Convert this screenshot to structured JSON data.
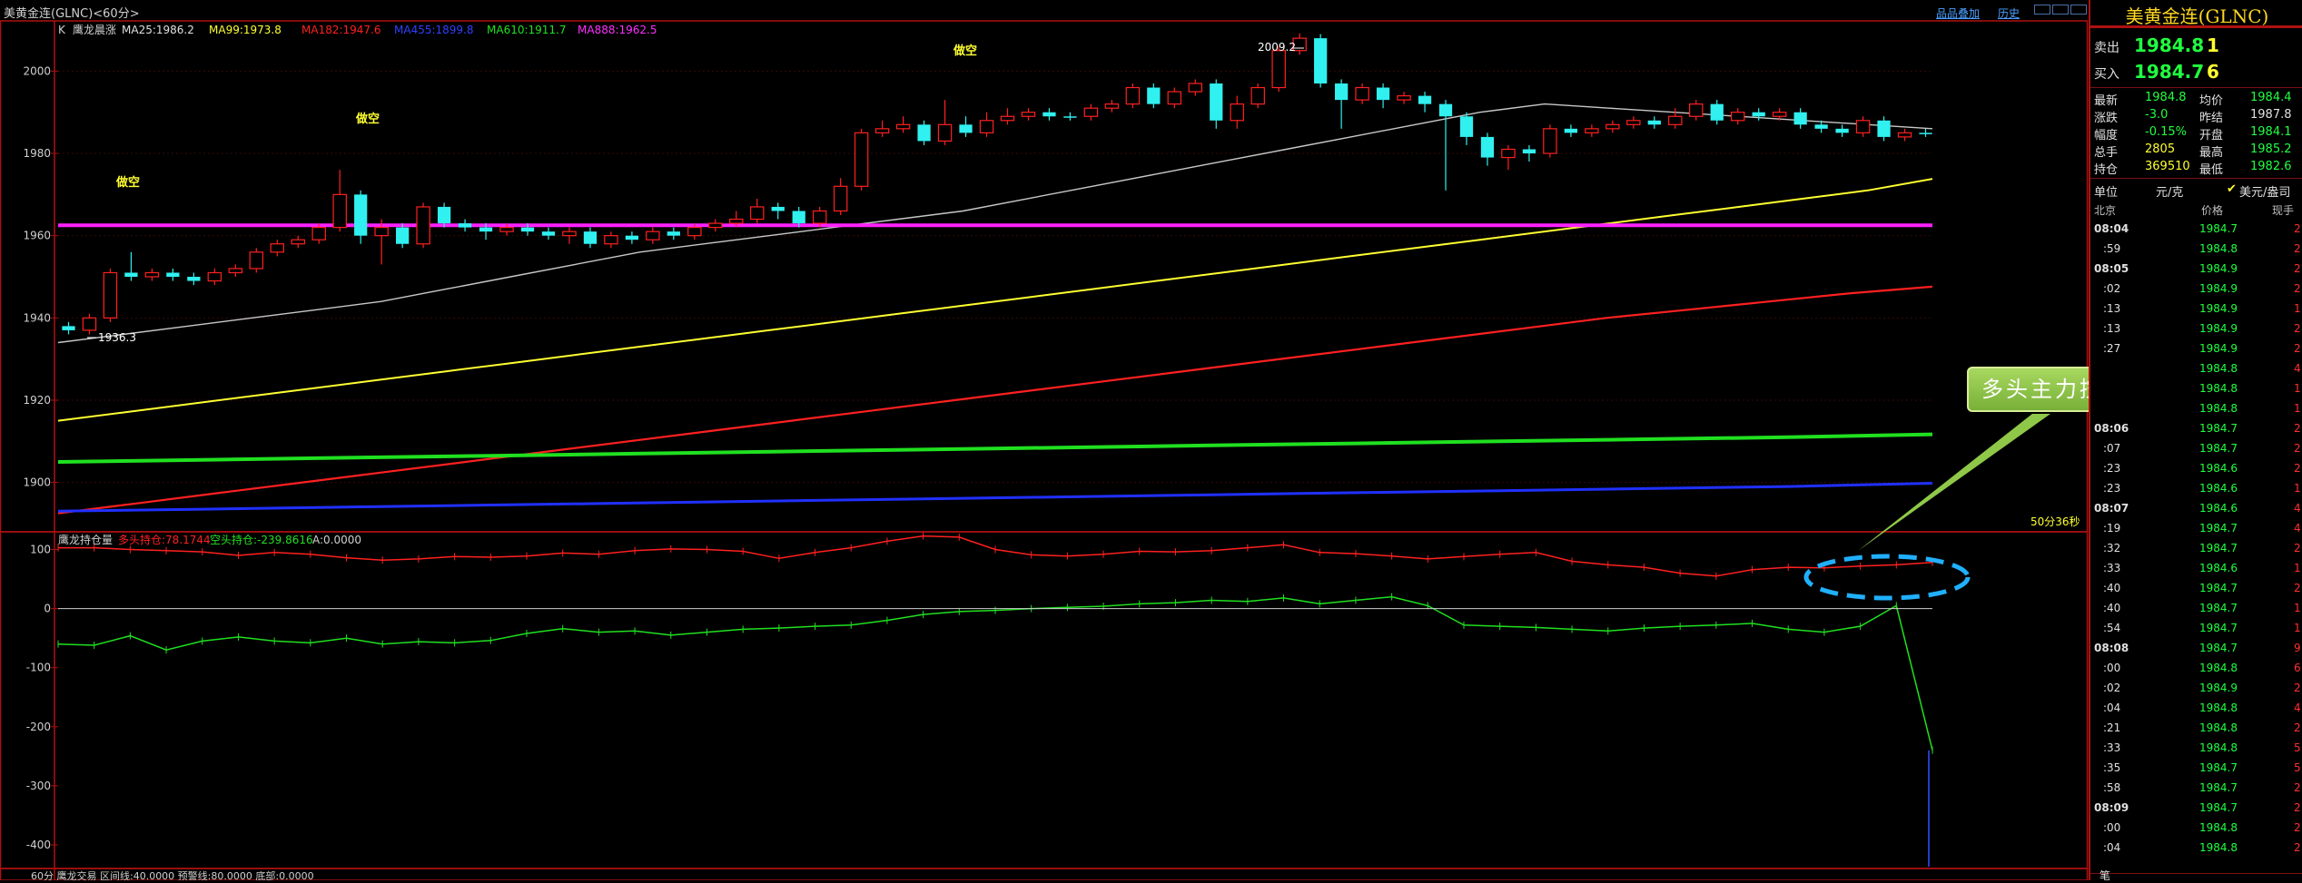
{
  "window": {
    "title": "美黄金连(GLNC)<60分>"
  },
  "toolbar": {
    "add_product": "品品叠加",
    "history": "历史",
    "colors": {
      "link": "#4aa0ff"
    }
  },
  "main_panel": {
    "indicator_header": {
      "prefix": "K",
      "name": "鹰龙晨涨",
      "ma25": "MA25:1986.2",
      "ma99": "MA99:1973.8",
      "ma182": "MA182:1947.6",
      "ma455": "MA455:1899.8",
      "ma610": "MA610:1911.7",
      "ma888": "MA888:1962.5"
    },
    "price_labels": {
      "high": "2009.2",
      "low": "1936.3"
    },
    "annotations": [
      "做空",
      "做空",
      "做空"
    ],
    "timer": "50分36秒"
  },
  "sub_panel": {
    "header": {
      "name": "鹰龙持仓量",
      "long": "多头持仓:78.1744",
      "short": "空头持仓:-239.8616",
      "a": "A:0.0000"
    }
  },
  "bottom_panel": {
    "header": "60分  鹰龙交易  区间线:40.0000  预警线:80.0000  底部:0.0000"
  },
  "callout": {
    "text": "多头主力控盘并且增仓"
  },
  "chart_data": [
    {
      "type": "candlestick",
      "title": "",
      "ylim": [
        1888,
        2012
      ],
      "yticks": [
        1900,
        1920,
        1940,
        1960,
        1980,
        2000
      ],
      "grid": false,
      "series": [
        {
          "name": "MA25",
          "color": "#c8c8c8",
          "values": [
            1934,
            1936,
            1938,
            1940,
            1942,
            1944,
            1947,
            1950,
            1953,
            1956,
            1958,
            1960,
            1962,
            1964,
            1966,
            1969,
            1972,
            1975,
            1978,
            1981,
            1984,
            1987,
            1990,
            1992,
            1991,
            1990,
            1989,
            1988,
            1987,
            1986
          ]
        },
        {
          "name": "MA99",
          "color": "#ffff30",
          "values": [
            1915,
            1917,
            1919,
            1921,
            1923,
            1925,
            1927,
            1929,
            1931,
            1933,
            1935,
            1937,
            1939,
            1941,
            1943,
            1945,
            1947,
            1949,
            1951,
            1953,
            1955,
            1957,
            1959,
            1961,
            1963,
            1965,
            1967,
            1969,
            1971,
            1973.8
          ]
        },
        {
          "name": "MA182",
          "color": "#ff2020",
          "values": [
            1892.5,
            1895,
            1897.5,
            1900,
            1902.5,
            1905,
            1907.5,
            1910,
            1912.5,
            1915,
            1917.5,
            1920,
            1922.5,
            1925,
            1927.5,
            1930,
            1932.5,
            1935,
            1937.5,
            1940,
            1942,
            1944,
            1946,
            1947.6
          ]
        },
        {
          "name": "MA455",
          "color": "#2030ff",
          "values": [
            1893,
            1893.5,
            1894,
            1894.5,
            1895,
            1895.5,
            1896,
            1896.5,
            1897,
            1897.5,
            1898,
            1898.5,
            1899,
            1899.8
          ]
        },
        {
          "name": "MA610",
          "color": "#20e020",
          "values": [
            1905,
            1905.5,
            1906,
            1906.5,
            1907,
            1907.5,
            1908,
            1908.5,
            1909,
            1909.5,
            1910,
            1910.5,
            1911,
            1911.7
          ]
        },
        {
          "name": "MA888",
          "color": "#ff20ff",
          "values": [
            1962.5,
            1962.5
          ]
        }
      ],
      "candles": [
        [
          1937,
          1938,
          1936,
          1939,
          0
        ],
        [
          1937,
          1940,
          1936,
          1941,
          1
        ],
        [
          1940,
          1951,
          1939,
          1952,
          1
        ],
        [
          1951,
          1950,
          1949,
          1956,
          0
        ],
        [
          1950,
          1951,
          1949,
          1952,
          1
        ],
        [
          1951,
          1950,
          1949,
          1952,
          0
        ],
        [
          1950,
          1949,
          1948,
          1951,
          0
        ],
        [
          1949,
          1951,
          1948,
          1952,
          1
        ],
        [
          1951,
          1952,
          1950,
          1953,
          1
        ],
        [
          1952,
          1956,
          1951,
          1957,
          1
        ],
        [
          1956,
          1958,
          1955,
          1959,
          1
        ],
        [
          1958,
          1959,
          1957,
          1960,
          1
        ],
        [
          1959,
          1962,
          1958,
          1963,
          1
        ],
        [
          1962,
          1970,
          1961,
          1976,
          1
        ],
        [
          1970,
          1960,
          1958,
          1971,
          0
        ],
        [
          1960,
          1962,
          1953,
          1964,
          1
        ],
        [
          1962,
          1958,
          1957,
          1963,
          0
        ],
        [
          1958,
          1967,
          1957,
          1968,
          1
        ],
        [
          1967,
          1963,
          1962,
          1968,
          0
        ],
        [
          1963,
          1962,
          1961,
          1964,
          0
        ],
        [
          1962,
          1961,
          1959,
          1963,
          0
        ],
        [
          1961,
          1962,
          1960,
          1963,
          1
        ],
        [
          1962,
          1961,
          1960,
          1963,
          0
        ],
        [
          1961,
          1960,
          1959,
          1962,
          0
        ],
        [
          1960,
          1961,
          1958,
          1962,
          1
        ],
        [
          1961,
          1958,
          1957,
          1962,
          0
        ],
        [
          1958,
          1960,
          1957,
          1961,
          1
        ],
        [
          1960,
          1959,
          1958,
          1961,
          0
        ],
        [
          1959,
          1961,
          1958,
          1962,
          1
        ],
        [
          1961,
          1960,
          1959,
          1962,
          0
        ],
        [
          1960,
          1962,
          1959,
          1963,
          1
        ],
        [
          1962,
          1963,
          1961,
          1964,
          1
        ],
        [
          1963,
          1964,
          1962,
          1966,
          1
        ],
        [
          1964,
          1967,
          1963,
          1969,
          1
        ],
        [
          1967,
          1966,
          1964,
          1968,
          0
        ],
        [
          1966,
          1963,
          1962,
          1967,
          0
        ],
        [
          1963,
          1966,
          1962,
          1967,
          1
        ],
        [
          1966,
          1972,
          1965,
          1974,
          1
        ],
        [
          1972,
          1985,
          1971,
          1986,
          1
        ],
        [
          1985,
          1986,
          1984,
          1988,
          1
        ],
        [
          1986,
          1987,
          1985,
          1989,
          1
        ],
        [
          1987,
          1983,
          1982,
          1988,
          0
        ],
        [
          1983,
          1987,
          1982,
          1993,
          1
        ],
        [
          1987,
          1985,
          1984,
          1989,
          0
        ],
        [
          1985,
          1988,
          1984,
          1990,
          1
        ],
        [
          1988,
          1989,
          1987,
          1991,
          1
        ],
        [
          1989,
          1990,
          1988,
          1991,
          1
        ],
        [
          1990,
          1989,
          1988,
          1991,
          0
        ],
        [
          1989,
          1989,
          1988,
          1990,
          0
        ],
        [
          1989,
          1991,
          1988,
          1992,
          1
        ],
        [
          1991,
          1992,
          1990,
          1993,
          1
        ],
        [
          1992,
          1996,
          1991,
          1997,
          1
        ],
        [
          1996,
          1992,
          1991,
          1997,
          0
        ],
        [
          1992,
          1995,
          1991,
          1996,
          1
        ],
        [
          1995,
          1997,
          1994,
          1998,
          1
        ],
        [
          1997,
          1988,
          1986,
          1998,
          0
        ],
        [
          1988,
          1992,
          1986,
          1994,
          1
        ],
        [
          1992,
          1996,
          1991,
          1997,
          1
        ],
        [
          1996,
          2005,
          1995,
          2006,
          1
        ],
        [
          2005,
          2008,
          2004,
          2009.2,
          1
        ],
        [
          2008,
          1997,
          1996,
          2009,
          0
        ],
        [
          1997,
          1993,
          1986,
          1998,
          0
        ],
        [
          1993,
          1996,
          1992,
          1997,
          1
        ],
        [
          1996,
          1993,
          1991,
          1997,
          0
        ],
        [
          1993,
          1994,
          1992,
          1995,
          1
        ],
        [
          1994,
          1992,
          1990,
          1995,
          0
        ],
        [
          1992,
          1989,
          1971,
          1993,
          0
        ],
        [
          1989,
          1984,
          1982,
          1990,
          0
        ],
        [
          1984,
          1979,
          1977,
          1985,
          0
        ],
        [
          1979,
          1981,
          1976,
          1982,
          1
        ],
        [
          1981,
          1980,
          1978,
          1982,
          0
        ],
        [
          1980,
          1986,
          1979,
          1987,
          1
        ],
        [
          1986,
          1985,
          1984,
          1987,
          0
        ],
        [
          1985,
          1986,
          1984,
          1987,
          1
        ],
        [
          1986,
          1987,
          1985,
          1988,
          1
        ],
        [
          1987,
          1988,
          1986,
          1989,
          1
        ],
        [
          1988,
          1987,
          1986,
          1989,
          0
        ],
        [
          1987,
          1989,
          1986,
          1991,
          1
        ],
        [
          1989,
          1992,
          1988,
          1993,
          1
        ],
        [
          1992,
          1988,
          1987,
          1993,
          0
        ],
        [
          1988,
          1990,
          1987,
          1991,
          1
        ],
        [
          1990,
          1989,
          1988,
          1991,
          0
        ],
        [
          1989,
          1990,
          1988,
          1991,
          1
        ],
        [
          1990,
          1987,
          1986,
          1991,
          0
        ],
        [
          1987,
          1986,
          1985,
          1988,
          0
        ],
        [
          1986,
          1985,
          1984,
          1987,
          0
        ],
        [
          1985,
          1988,
          1984,
          1989,
          1
        ],
        [
          1988,
          1984,
          1983,
          1989,
          0
        ],
        [
          1984,
          1985,
          1983,
          1986,
          1
        ],
        [
          1985,
          1984.8,
          1984,
          1986,
          0
        ]
      ]
    },
    {
      "type": "line",
      "title": "",
      "ylim": [
        -440,
        130
      ],
      "yticks": [
        100,
        0,
        -100,
        -200,
        -300,
        -400
      ],
      "series": [
        {
          "name": "多头持仓",
          "color": "#ff2020",
          "values": [
            103,
            103,
            100,
            98,
            96,
            90,
            95,
            92,
            86,
            82,
            84,
            88,
            87,
            89,
            94,
            92,
            98,
            101,
            100,
            97,
            85,
            95,
            103,
            114,
            123,
            121,
            100,
            91,
            89,
            92,
            97,
            96,
            98,
            103,
            108,
            95,
            93,
            89,
            84,
            88,
            92,
            95,
            80,
            74,
            70,
            60,
            55,
            66,
            70,
            69,
            72,
            74,
            78.17
          ]
        },
        {
          "name": "空头持仓",
          "color": "#20e020",
          "values": [
            -60,
            -62,
            -46,
            -70,
            -55,
            -48,
            -55,
            -58,
            -50,
            -60,
            -56,
            -58,
            -54,
            -42,
            -34,
            -40,
            -38,
            -45,
            -40,
            -35,
            -33,
            -30,
            -28,
            -20,
            -10,
            -5,
            -3,
            0,
            2,
            4,
            8,
            10,
            14,
            12,
            18,
            8,
            14,
            20,
            5,
            -28,
            -30,
            -32,
            -35,
            -38,
            -33,
            -30,
            -28,
            -25,
            -35,
            -40,
            -30,
            5,
            -239.86
          ]
        },
        {
          "name": "A",
          "color": "#d0d0d0",
          "values": [
            0,
            0
          ]
        }
      ]
    }
  ],
  "quote_panel": {
    "title": "美黄金连(GLNC)",
    "sell": {
      "label": "卖出",
      "price": "1984.8",
      "qty": "1"
    },
    "buy": {
      "label": "买入",
      "price": "1984.7",
      "qty": "6"
    },
    "stats": [
      {
        "l1": "最新",
        "v1": "1984.8",
        "l2": "均价",
        "v2": "1984.4",
        "c1": "#20ff40",
        "c2": "#20ff40"
      },
      {
        "l1": "涨跌",
        "v1": "-3.0",
        "l2": "昨结",
        "v2": "1987.8",
        "c1": "#20ff40",
        "c2": "#e0e0e0"
      },
      {
        "l1": "幅度",
        "v1": "-0.15%",
        "l2": "开盘",
        "v2": "1984.1",
        "c1": "#20ff40",
        "c2": "#20ff40"
      },
      {
        "l1": "总手",
        "v1": "2805",
        "l2": "最高",
        "v2": "1985.2",
        "c1": "#ffff30",
        "c2": "#20ff40"
      },
      {
        "l1": "持仓",
        "v1": "369510",
        "l2": "最低",
        "v2": "1982.6",
        "c1": "#ffff30",
        "c2": "#20ff40"
      }
    ],
    "unit_label": "单位",
    "unit_value": "元/克",
    "unit_option": "美元/盎司",
    "col_time": "北京",
    "col_price": "价格",
    "col_vol": "现手",
    "ticks": [
      {
        "t": "08:04",
        "p": "1984.7",
        "v": "2",
        "bold": true
      },
      {
        "t": ":59",
        "p": "1984.8",
        "v": "2"
      },
      {
        "t": "08:05",
        "p": "1984.9",
        "v": "2",
        "bold": true
      },
      {
        "t": ":02",
        "p": "1984.9",
        "v": "2"
      },
      {
        "t": ":13",
        "p": "1984.9",
        "v": "1"
      },
      {
        "t": ":13",
        "p": "1984.9",
        "v": "2"
      },
      {
        "t": ":27",
        "p": "1984.9",
        "v": "2"
      },
      {
        "t": "",
        "p": "1984.8",
        "v": "4"
      },
      {
        "t": "",
        "p": "1984.8",
        "v": "1"
      },
      {
        "t": "",
        "p": "1984.8",
        "v": "1"
      },
      {
        "t": "08:06",
        "p": "1984.7",
        "v": "2",
        "bold": true
      },
      {
        "t": ":07",
        "p": "1984.7",
        "v": "2"
      },
      {
        "t": ":23",
        "p": "1984.6",
        "v": "2"
      },
      {
        "t": ":23",
        "p": "1984.6",
        "v": "1"
      },
      {
        "t": "08:07",
        "p": "1984.6",
        "v": "4",
        "bold": true
      },
      {
        "t": ":19",
        "p": "1984.7",
        "v": "4"
      },
      {
        "t": ":32",
        "p": "1984.7",
        "v": "2"
      },
      {
        "t": ":33",
        "p": "1984.6",
        "v": "1"
      },
      {
        "t": ":40",
        "p": "1984.7",
        "v": "2"
      },
      {
        "t": ":40",
        "p": "1984.7",
        "v": "1"
      },
      {
        "t": ":54",
        "p": "1984.7",
        "v": "1"
      },
      {
        "t": "08:08",
        "p": "1984.7",
        "v": "9",
        "bold": true
      },
      {
        "t": ":00",
        "p": "1984.8",
        "v": "6"
      },
      {
        "t": ":02",
        "p": "1984.9",
        "v": "2"
      },
      {
        "t": ":04",
        "p": "1984.8",
        "v": "4"
      },
      {
        "t": ":21",
        "p": "1984.8",
        "v": "2"
      },
      {
        "t": ":33",
        "p": "1984.8",
        "v": "5"
      },
      {
        "t": ":35",
        "p": "1984.7",
        "v": "5"
      },
      {
        "t": ":58",
        "p": "1984.7",
        "v": "2"
      },
      {
        "t": "08:09",
        "p": "1984.7",
        "v": "2",
        "bold": true
      },
      {
        "t": ":00",
        "p": "1984.8",
        "v": "2"
      },
      {
        "t": ":04",
        "p": "1984.8",
        "v": "2"
      }
    ],
    "footer": "笔"
  }
}
